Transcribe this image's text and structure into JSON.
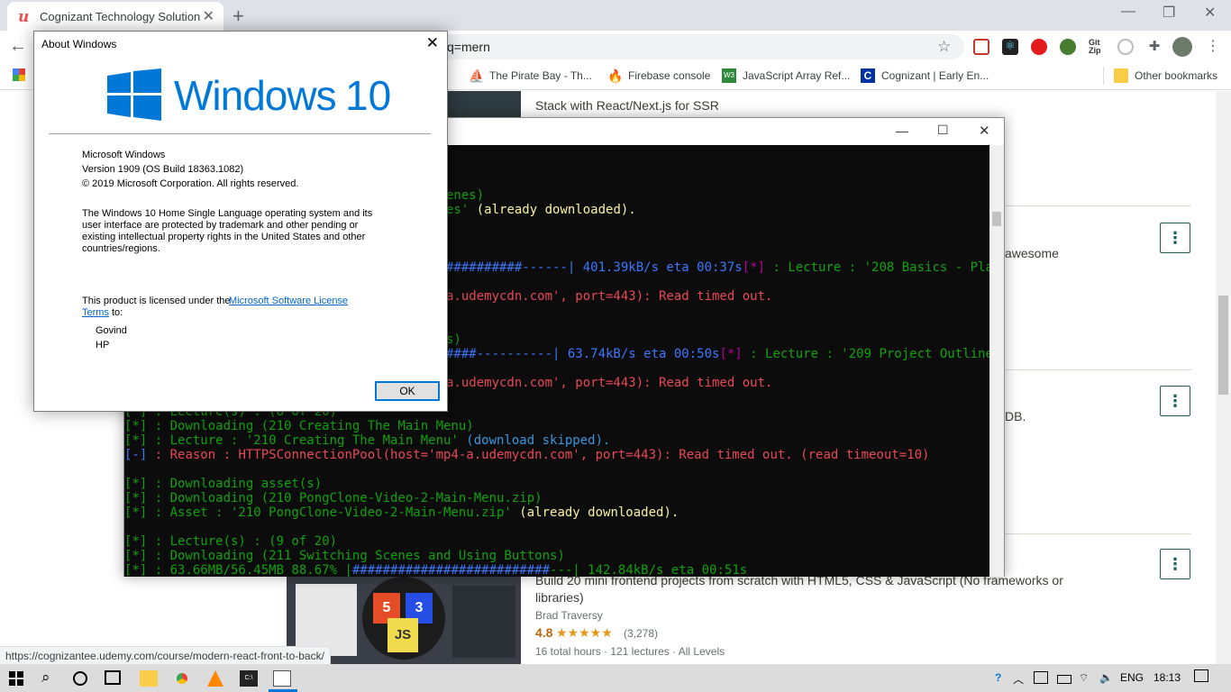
{
  "browser": {
    "tab_title": "Cognizant Technology Solutions",
    "url_fragment": "q=mern",
    "bookmarks": [
      "The Pirate Bay - Th...",
      "Firebase console",
      "JavaScript Array Ref...",
      "Cognizant | Early En...",
      "Other bookmarks"
    ],
    "status_url": "https://cognizantee.udemy.com/course/modern-react-front-to-back/"
  },
  "page": {
    "course1_desc": "Stack with React/Next.js for SSR",
    "course2_fragment": "awesome",
    "course3_fragment": "DB.",
    "course4_desc": "Build 20 mini frontend projects from scratch with HTML5, CSS & JavaScript (No frameworks or libraries)",
    "course4_author": "Brad Traversy",
    "course4_rating": "4.8",
    "course4_stars": "★★★★★",
    "course4_reviews": "(3,278)",
    "course4_meta": "16 total hours · 121 lectures · All Levels"
  },
  "about": {
    "title": "About Windows",
    "logo_text": "Windows",
    "logo_num": "10",
    "line1": "Microsoft Windows",
    "line2": "Version 1909 (OS Build 18363.1082)",
    "line3": "© 2019 Microsoft Corporation. All rights reserved.",
    "para": "The Windows 10 Home Single Language operating system and its user interface are protected by trademark and other pending or existing intellectual property rights in the United States and other countries/regions.",
    "license_pre": "This product is licensed under the",
    "license_link": "Microsoft Software License",
    "license_link2": "Terms",
    "license_post": "to:",
    "user": "Govind",
    "org": "HP",
    "ok": "OK"
  },
  "console": {
    "l1": "enes)",
    "l2a": "es'",
    "l2b": " (already downloaded).",
    "l3a": "##########------| 401.39kB/s eta 00:37s",
    "l3b": "[*]",
    "l3c": " : Lecture : '208 Basics - Play So",
    "l4": "a.udemycdn.com', port=443): Read timed out.",
    "l5": "s)",
    "l6a": "####----------| 63.74kB/s eta 00:50s",
    "l6b": "[*]",
    "l6c": " : Lecture : '209 Project Outline - P",
    "l7": "a.udemycdn.com', port=443): Read timed out.",
    "l8": "[*] : Lecture(s) : (8 of 20)",
    "l9": "[*] : Downloading (210 Creating The Main Menu)",
    "l10a": "[*] : Lecture : '210 Creating The Main Menu'",
    "l10b": " (download skipped).",
    "l11a": "[-]",
    "l11b": " : Reason : HTTPSConnectionPool(host='mp4-a.udemycdn.com', port=443): Read timed out. (read timeout=10)",
    "l12": "[*] : Downloading asset(s)",
    "l13": "[*] : Downloading (210 PongClone-Video-2-Main-Menu.zip)",
    "l14a": "[*] : Asset : '210 PongClone-Video-2-Main-Menu.zip'",
    "l14b": " (already downloaded).",
    "l15": "[*] : Lecture(s) : (9 of 20)",
    "l16": "[*] : Downloading (211 Switching Scenes and Using Buttons)",
    "l17a": "[*] : 63.66MB/56.45MB 88.67% |",
    "l17b": "##########################",
    "l17c": "---| 142.84kB/s eta 00:51s"
  },
  "taskbar": {
    "lang": "ENG",
    "time": "18:13"
  },
  "colors": {
    "udemy_red": "#ec5252",
    "win_blue": "#0078d7",
    "rating": "#b4690e"
  }
}
